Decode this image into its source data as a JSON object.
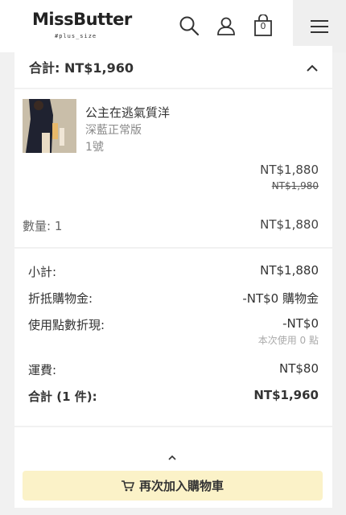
{
  "header": {
    "logo_main": "MissButter",
    "logo_sub": "#plus_size",
    "cart_count": "0",
    "icons": [
      "search-icon",
      "user-icon",
      "cart-icon",
      "menu-icon"
    ]
  },
  "summary": {
    "title": "合計: NT$1,960"
  },
  "item": {
    "name": "公主在逃氣質洋",
    "variant": "深藍正常版",
    "size": "1號",
    "price": "NT$1,880",
    "original_price": "NT$1,980",
    "quantity_label": "數量: 1",
    "line_total": "NT$1,880"
  },
  "totals": {
    "subtotal_label": "小計:",
    "subtotal_value": "NT$1,880",
    "credit_label": "折抵購物金:",
    "credit_value": "-NT$0 購物金",
    "points_label": "使用點數折現:",
    "points_value": "-NT$0",
    "points_note": "本次使用 0 點",
    "shipping_label": "運費:",
    "shipping_value": "NT$80",
    "total_label": "合計 (1 件):",
    "total_value": "NT$1,960"
  },
  "actions": {
    "add_again_label": "再次加入購物車"
  },
  "colors": {
    "button_bg": "#fbf2c8",
    "page_bg": "#f1f1f1"
  }
}
